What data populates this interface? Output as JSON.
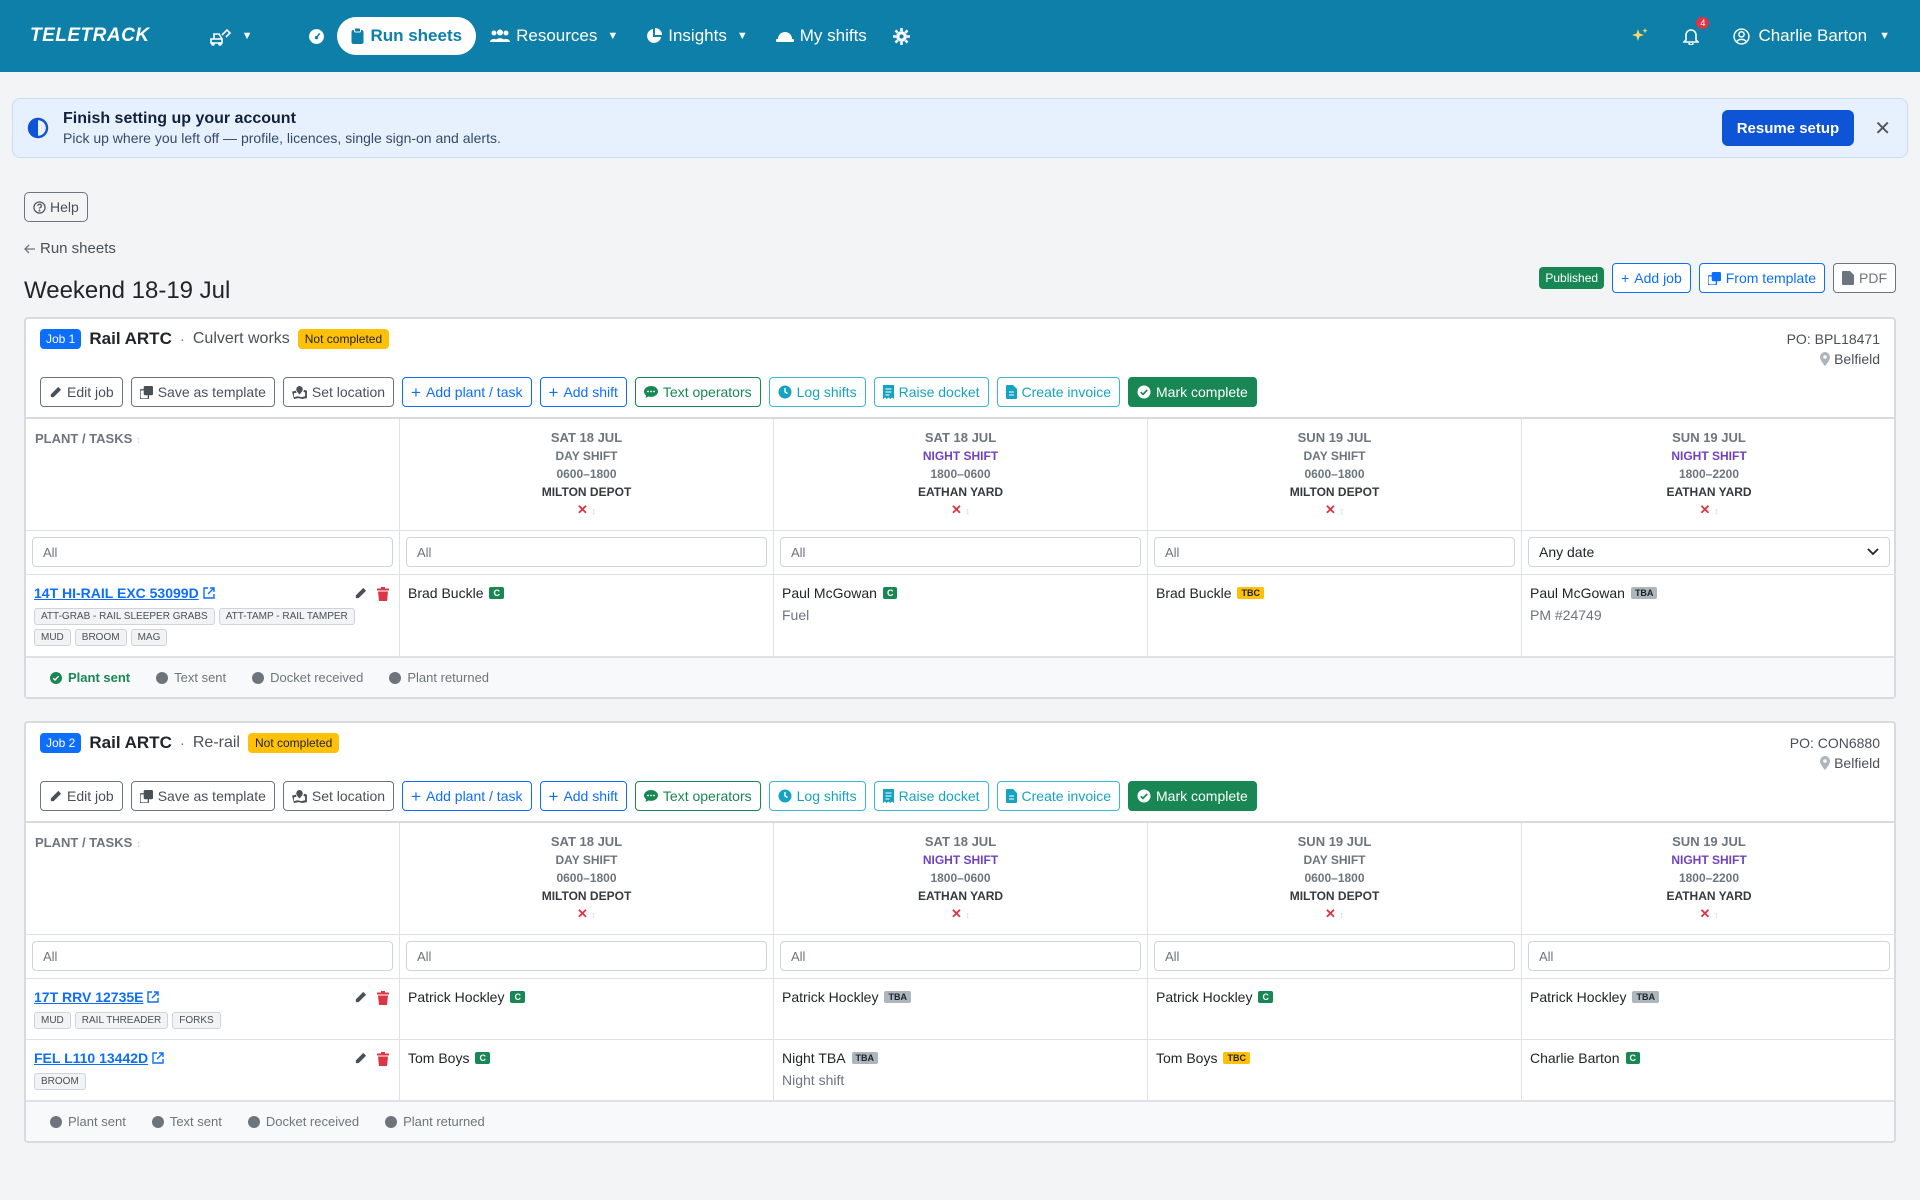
{
  "nav": {
    "logo": "TELETRACK",
    "items": [
      {
        "label": "Run sheets"
      },
      {
        "label": "Resources"
      },
      {
        "label": "Insights"
      },
      {
        "label": "My shifts"
      }
    ],
    "notifications_count": "4",
    "user_name": "Charlie Barton"
  },
  "alert": {
    "title": "Finish setting up your account",
    "subtitle": "Pick up where you left off — profile, licences, single sign-on and alerts.",
    "button": "Resume setup"
  },
  "help_label": "Help",
  "breadcrumb": "Run sheets",
  "page_title": "Weekend 18-19 Jul",
  "title_actions": {
    "status": "Published",
    "add_job": "Add job",
    "from_template": "From template",
    "pdf": "PDF"
  },
  "actions": {
    "edit_job": "Edit job",
    "save_template": "Save as template",
    "set_location": "Set location",
    "add_plant": "Add plant / task",
    "add_shift": "Add shift",
    "text_operators": "Text operators",
    "log_shifts": "Log shifts",
    "raise_docket": "Raise docket",
    "create_invoice": "Create invoice",
    "mark_complete": "Mark complete"
  },
  "table": {
    "plant_header": "PLANT / TASKS",
    "shifts": [
      {
        "date": "SAT 18 JUL",
        "shift": "DAY SHIFT",
        "hours": "0600–1800",
        "location": "MILTON DEPOT",
        "night": false
      },
      {
        "date": "SAT 18 JUL",
        "shift": "NIGHT SHIFT",
        "hours": "1800–0600",
        "location": "EATHAN YARD",
        "night": true
      },
      {
        "date": "SUN 19 JUL",
        "shift": "DAY SHIFT",
        "hours": "0600–1800",
        "location": "MILTON DEPOT",
        "night": false
      },
      {
        "date": "SUN 19 JUL",
        "shift": "NIGHT SHIFT",
        "hours": "1800–2200",
        "location": "EATHAN YARD",
        "night": true
      }
    ],
    "filter_all": "All",
    "filter_any_date": "Any date"
  },
  "status_labels": {
    "plant_sent": "Plant sent",
    "text_sent": "Text sent",
    "docket_received": "Docket received",
    "plant_returned": "Plant returned"
  },
  "jobs": [
    {
      "badge": "Job 1",
      "client": "Rail ARTC",
      "type": "Culvert works",
      "status": "Not completed",
      "po": "PO: BPL18471",
      "location": "Belfield",
      "plants": [
        {
          "name": "14T HI-RAIL EXC 53099D",
          "chips": [
            "ATT-GRAB - RAIL SLEEPER GRABS",
            "ATT-TAMP - RAIL TAMPER",
            "MUD",
            "BROOM",
            "MAG"
          ],
          "cells": [
            {
              "op": "Brad Buckle",
              "badge": "C",
              "sub": ""
            },
            {
              "op": "Paul McGowan",
              "badge": "C",
              "sub": "Fuel"
            },
            {
              "op": "Brad Buckle",
              "badge": "TBC",
              "sub": ""
            },
            {
              "op": "Paul McGowan",
              "badge": "TBA",
              "sub": "PM #24749"
            }
          ]
        }
      ],
      "plant_sent_done": true
    },
    {
      "badge": "Job 2",
      "client": "Rail ARTC",
      "type": "Re-rail",
      "status": "Not completed",
      "po": "PO: CON6880",
      "location": "Belfield",
      "plants": [
        {
          "name": "17T RRV 12735E",
          "chips": [
            "MUD",
            "RAIL THREADER",
            "FORKS"
          ],
          "cells": [
            {
              "op": "Patrick Hockley",
              "badge": "C",
              "sub": ""
            },
            {
              "op": "Patrick Hockley",
              "badge": "TBA",
              "sub": ""
            },
            {
              "op": "Patrick Hockley",
              "badge": "C",
              "sub": ""
            },
            {
              "op": "Patrick Hockley",
              "badge": "TBA",
              "sub": ""
            }
          ]
        },
        {
          "name": "FEL L110 13442D",
          "chips": [
            "BROOM"
          ],
          "cells": [
            {
              "op": "Tom Boys",
              "badge": "C",
              "sub": ""
            },
            {
              "op": "Night TBA",
              "badge": "TBA",
              "sub": "Night shift"
            },
            {
              "op": "Tom Boys",
              "badge": "TBC",
              "sub": ""
            },
            {
              "op": "Charlie Barton",
              "badge": "C",
              "sub": ""
            }
          ]
        }
      ],
      "plant_sent_done": false
    }
  ],
  "colors": {
    "navbar": "#0d7fa8",
    "primary": "#0d55d6",
    "success": "#198754",
    "warning": "#ffc107",
    "danger": "#dc3545",
    "night": "#6f42c1"
  }
}
